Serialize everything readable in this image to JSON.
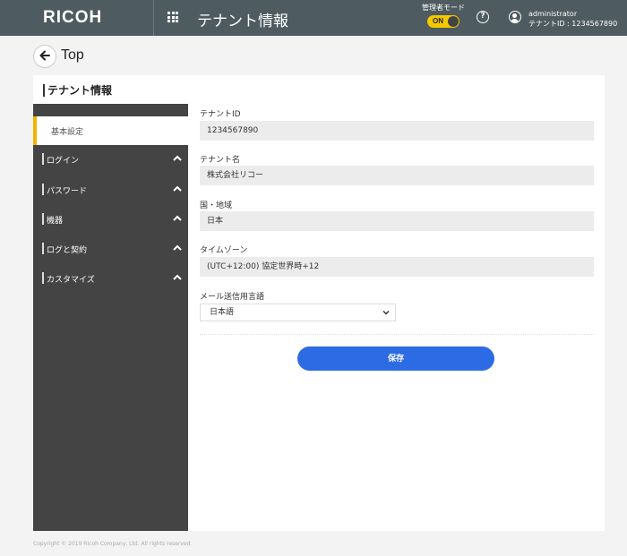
{
  "header": {
    "logo": "RICOH",
    "apps_icon": "apps-grid-icon",
    "title": "テナント情報",
    "admin_mode_label": "管理者モード",
    "admin_mode_toggle": "ON",
    "admin_mode_on": true,
    "help_icon": "help-circle-icon",
    "user_icon": "user-account-icon",
    "user_name": "administrator",
    "tenant_id_text": "テナントID : 1234567890"
  },
  "nav": {
    "back_icon": "arrow-left-icon",
    "back_label": "Top"
  },
  "panel": {
    "title": "テナント情報"
  },
  "sidebar": {
    "active_item": "基本設定",
    "items": [
      {
        "label": "ログイン",
        "icon": "chevron-up-icon"
      },
      {
        "label": "パスワード",
        "icon": "chevron-up-icon"
      },
      {
        "label": "機器",
        "icon": "chevron-up-icon"
      },
      {
        "label": "ログと契約",
        "icon": "chevron-up-icon"
      },
      {
        "label": "カスタマイズ",
        "icon": "chevron-up-icon"
      }
    ]
  },
  "form": {
    "fields": [
      {
        "label": "テナントID",
        "value": "1234567890"
      },
      {
        "label": "テナント名",
        "value": "株式会社リコー"
      },
      {
        "label": "国・地域",
        "value": "日本"
      },
      {
        "label": "タイムゾーン",
        "value": "(UTC+12:00) 協定世界時+12"
      }
    ],
    "language_label": "メール送信用言語",
    "language_value": "日本語",
    "save_label": "保存"
  },
  "colors": {
    "header_bg": "#4e5b60",
    "accent_yellow": "#f5c900",
    "active_marker": "#f0b400",
    "sidebar_bg": "#444444",
    "primary_button": "#2d6be4"
  },
  "footer": {
    "copyright": "Copyright © 2019 Ricoh Company, Ltd. All rights reserved."
  }
}
